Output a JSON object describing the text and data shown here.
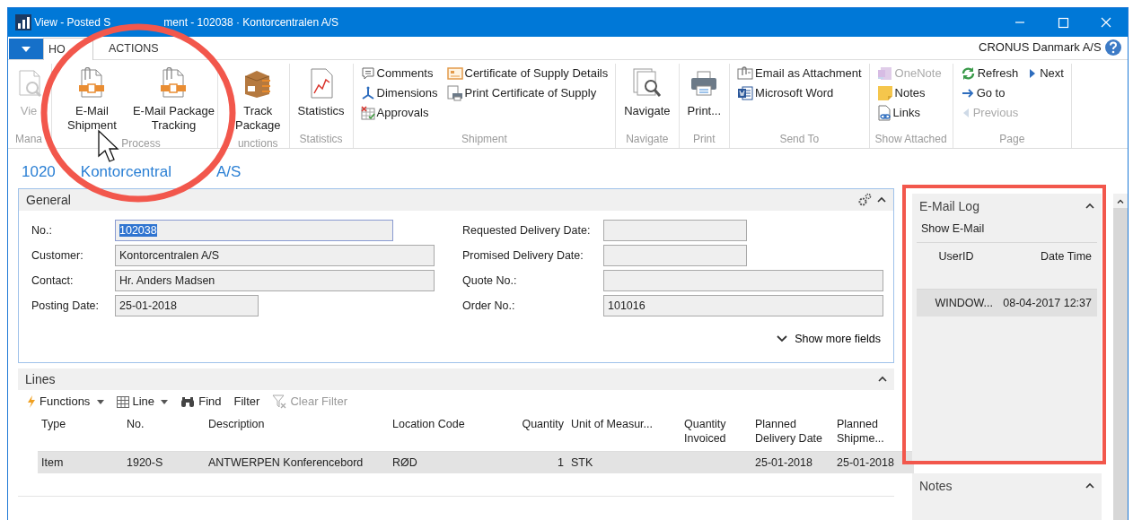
{
  "window": {
    "title_parts": [
      "View - Posted S",
      "ment - 102038 · Kontorcentralen A/S"
    ]
  },
  "ribbon_tabs": [
    {
      "label": "HO",
      "selected": true
    },
    {
      "label": "ACTIONS",
      "selected": false
    }
  ],
  "company": "CRONUS Danmark A/S",
  "ribbon_groups": [
    {
      "label": "Mana",
      "items": [
        {
          "label_lines": [
            "Vie"
          ],
          "disabled": true
        }
      ]
    },
    {
      "label": "Process",
      "items": [
        {
          "label_lines": [
            "E-Mail",
            "Shipment"
          ],
          "disabled": false
        },
        {
          "label_lines": [
            "E-Mail Package",
            "Tracking"
          ],
          "disabled": false
        }
      ]
    },
    {
      "label": "unctions",
      "items": [
        {
          "label_lines": [
            "Track",
            "Package"
          ],
          "disabled": false
        }
      ]
    },
    {
      "label": "Statistics",
      "items": [
        {
          "label_lines": [
            "Statistics"
          ],
          "disabled": false
        }
      ]
    },
    {
      "label": "Shipment",
      "columns": [
        [
          {
            "label": "Comments",
            "disabled": false
          },
          {
            "label": "Dimensions",
            "disabled": false
          },
          {
            "label": "Approvals",
            "disabled": false
          }
        ],
        [
          {
            "label": "Certificate of Supply Details",
            "disabled": false
          },
          {
            "label": "Print Certificate of Supply",
            "disabled": false
          }
        ]
      ]
    },
    {
      "label": "Navigate",
      "items": [
        {
          "label_lines": [
            "Navigate"
          ],
          "disabled": false
        }
      ]
    },
    {
      "label": "Print",
      "items": [
        {
          "label_lines": [
            "Print..."
          ],
          "disabled": false
        }
      ]
    },
    {
      "label": "Send To",
      "columns": [
        [
          {
            "label": "Email as Attachment",
            "disabled": false
          },
          {
            "label": "Microsoft Word",
            "disabled": false
          }
        ]
      ]
    },
    {
      "label": "Show Attached",
      "columns": [
        [
          {
            "label": "OneNote",
            "disabled": true
          },
          {
            "label": "Notes",
            "disabled": false
          },
          {
            "label": "Links",
            "disabled": false
          }
        ]
      ]
    },
    {
      "label": "Page",
      "columns": [
        [
          {
            "label": "Refresh",
            "disabled": false
          },
          {
            "label": "Go to",
            "disabled": false
          },
          {
            "label": "Previous",
            "disabled": true
          }
        ],
        [
          {
            "label": "Next",
            "disabled": false
          }
        ]
      ]
    }
  ],
  "page_header_parts": [
    "1020",
    "Kontorcentral",
    "A/S"
  ],
  "general": {
    "title": "General",
    "expanded": true,
    "left_fields": [
      {
        "label": "No.:",
        "value": "102038",
        "focused": true
      },
      {
        "label": "Customer:",
        "value": "Kontorcentralen A/S",
        "focused": false
      },
      {
        "label": "Contact:",
        "value": "Hr. Anders Madsen",
        "focused": false
      },
      {
        "label": "Posting Date:",
        "value": "25-01-2018",
        "focused": false
      }
    ],
    "right_fields": [
      {
        "label": "Requested Delivery Date:",
        "focused": false
      },
      {
        "label": "Promised Delivery Date:",
        "focused": false
      },
      {
        "label": "Quote No.:",
        "focused": false
      },
      {
        "label": "Order No.:",
        "value": "101016",
        "focused": false
      }
    ],
    "show_more": "Show more fields"
  },
  "lines": {
    "title": "Lines",
    "expanded": true,
    "toolbar": [
      {
        "label": "Functions",
        "dropdown": true,
        "disabled": false
      },
      {
        "label": "Line",
        "dropdown": true,
        "disabled": false
      },
      {
        "label": "Find",
        "dropdown": false,
        "disabled": false
      },
      {
        "label": "Filter",
        "dropdown": false,
        "disabled": false
      },
      {
        "label": "Clear Filter",
        "dropdown": false,
        "disabled": true
      }
    ],
    "columns": [
      "Type",
      "No.",
      "Description",
      "Location Code",
      "Quantity",
      "Unit of Measur...",
      "Quantity Invoiced",
      "Planned Delivery Date",
      "Planned Shipme..."
    ],
    "rows": [
      {
        "cells": [
          "Item",
          "1920-S",
          "ANTWERPEN Konferencebord",
          "RØD",
          "1",
          "STK",
          null,
          "25-01-2018",
          "25-01-2018"
        ],
        "selected": true
      }
    ]
  },
  "factboxes": [
    {
      "title": "E-Mail Log",
      "expanded": true,
      "action": "Show E-Mail",
      "columns": [
        "UserID",
        "Date Time"
      ],
      "rows": [
        {
          "cells": [
            "WINDOW...",
            "08-04-2017 12:37"
          ],
          "selected": true
        }
      ]
    },
    {
      "title": "Notes",
      "expanded": true
    }
  ],
  "annotations": [
    {
      "kind": "circle",
      "color": "#f2574c"
    },
    {
      "kind": "rectangle",
      "color": "#f2574c"
    },
    {
      "kind": "cursor"
    }
  ]
}
